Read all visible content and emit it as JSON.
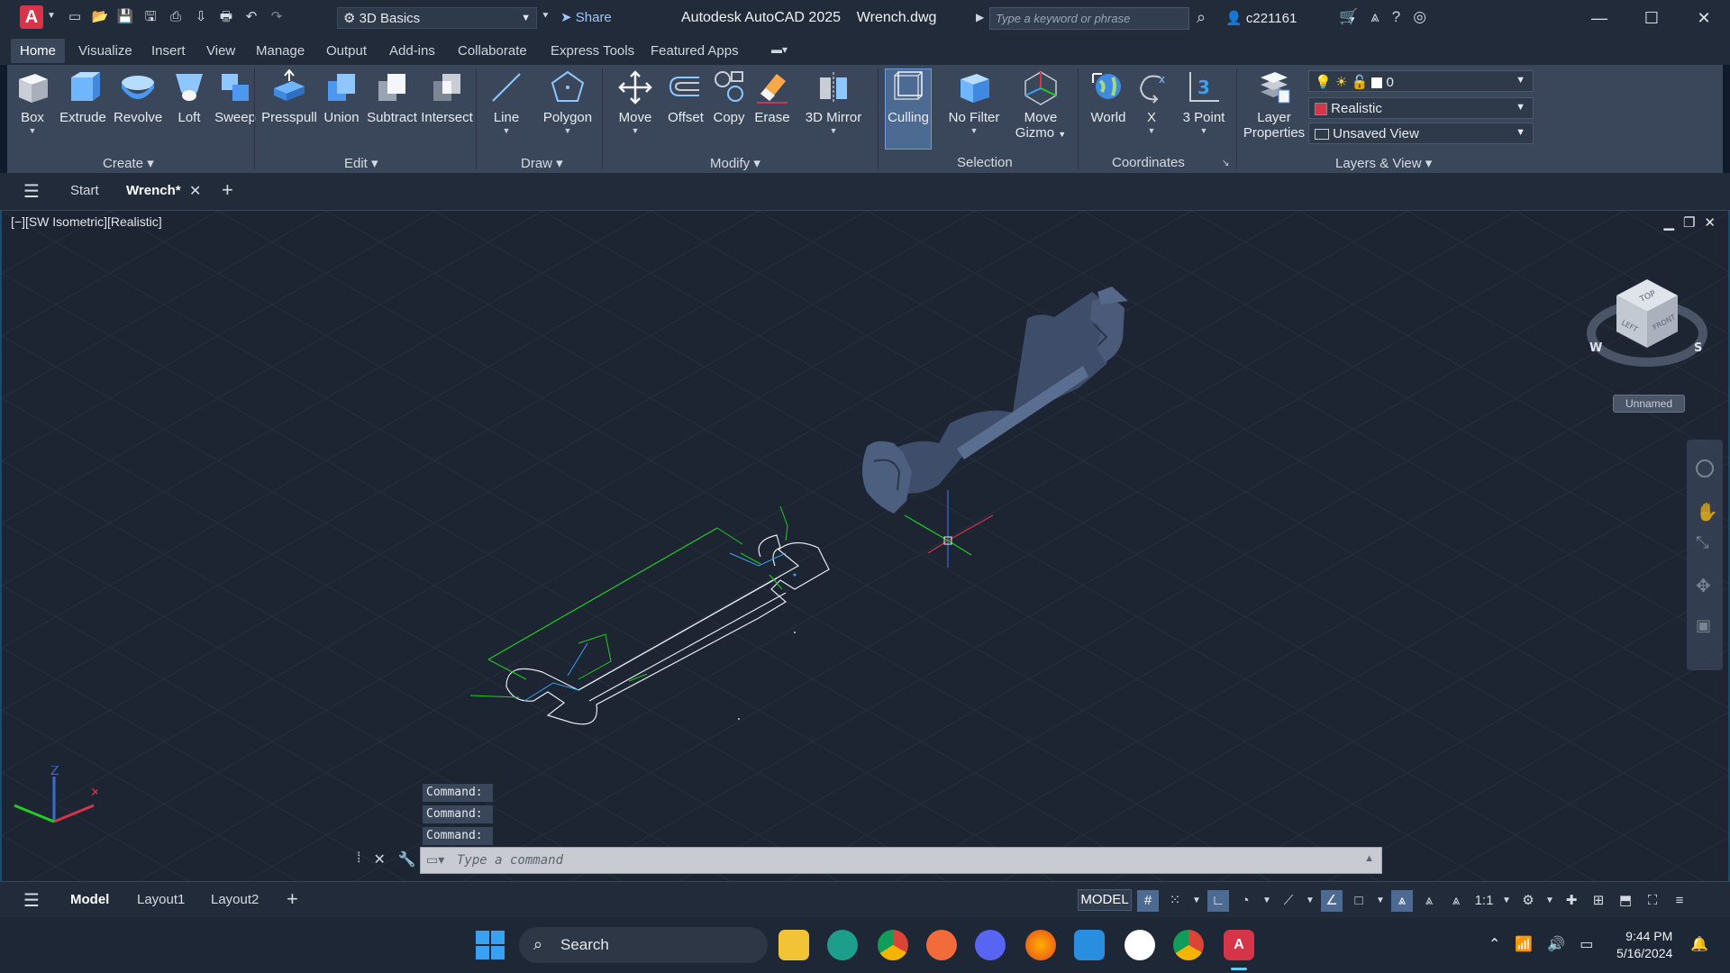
{
  "titlebar": {
    "workspace": "3D Basics",
    "share": "Share",
    "app_title": "Autodesk AutoCAD 2025",
    "file_name": "Wrench.dwg",
    "search_placeholder": "Type a keyword or phrase",
    "user": "c221161"
  },
  "ribbon_tabs": [
    "Home",
    "Visualize",
    "Insert",
    "View",
    "Manage",
    "Output",
    "Add-ins",
    "Collaborate",
    "Express Tools",
    "Featured Apps"
  ],
  "ribbon": {
    "create": {
      "title": "Create",
      "tools": [
        "Box",
        "Extrude",
        "Revolve",
        "Loft",
        "Sweep"
      ]
    },
    "edit": {
      "title": "Edit",
      "tools": [
        "Presspull",
        "Union",
        "Subtract",
        "Intersect"
      ]
    },
    "draw": {
      "title": "Draw",
      "tools": [
        "Line",
        "Polygon"
      ]
    },
    "modify": {
      "title": "Modify",
      "tools": [
        "Move",
        "Offset",
        "Copy",
        "Erase",
        "3D Mirror"
      ]
    },
    "selection": {
      "title": "Selection",
      "culling": "Culling",
      "no_filter": "No Filter",
      "move_gizmo_1": "Move",
      "move_gizmo_2": "Gizmo"
    },
    "coordinates": {
      "title": "Coordinates",
      "world": "World",
      "x": "X",
      "three_point": "3 Point"
    },
    "layers": {
      "title": "Layers & View",
      "layer_props_1": "Layer",
      "layer_props_2": "Properties",
      "layer_value": "0",
      "visual_style": "Realistic",
      "view": "Unsaved View"
    }
  },
  "doc_tabs": {
    "start": "Start",
    "current": "Wrench*"
  },
  "viewport": {
    "label": "[−][SW Isometric][Realistic]",
    "viewcube_unnamed": "Unnamed",
    "cube_top": "TOP",
    "cube_front": "FRONT",
    "cube_left": "LEFT",
    "compass_w": "W",
    "compass_s": "S",
    "axis_z": "Z"
  },
  "command": {
    "history": [
      "Command:",
      "Command:",
      "Command:"
    ],
    "placeholder": "Type a command"
  },
  "status": {
    "tabs": [
      "Model",
      "Layout1",
      "Layout2"
    ],
    "mode": "MODEL",
    "scale": "1:1"
  },
  "taskbar": {
    "search": "Search",
    "time": "9:44 PM",
    "date": "5/16/2024"
  },
  "colors": {
    "accent": "#4d6a92",
    "autocad_red": "#d63449",
    "viewport_bg": "#1d2533",
    "dimension_green": "#22cc22",
    "wrench_blue": "#3e4e6a"
  }
}
